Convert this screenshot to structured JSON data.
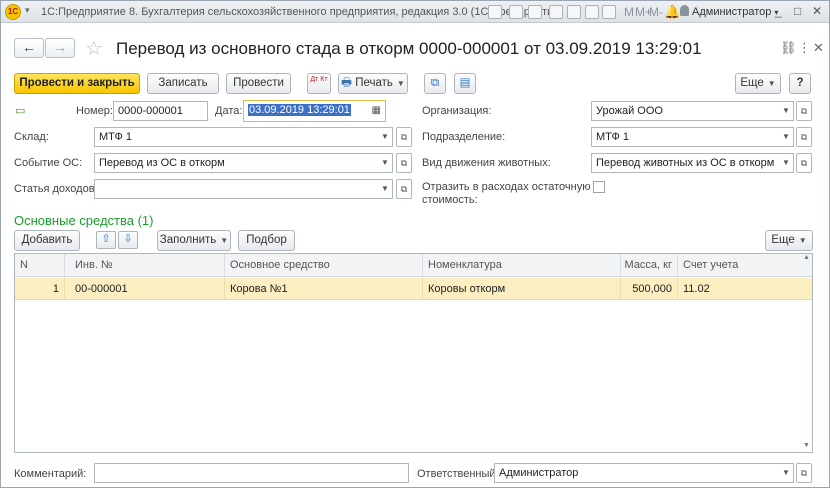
{
  "window": {
    "app_title": "1С:Предприятие 8. Бухгалтерия сельскохозяйственного предприятия, редакция 3.0  (1С:Предприятие)",
    "logo": "1С",
    "user": "Администратор",
    "toolbar_m_labels": [
      "M",
      "M+",
      "M-"
    ]
  },
  "document": {
    "title": "Перевод из основного стада в откорм 0000-000001 от 03.09.2019 13:29:01"
  },
  "toolbar": {
    "post_close": "Провести и закрыть",
    "write": "Записать",
    "post": "Провести",
    "dt_kt": "Дт Кт",
    "print": "Печать",
    "more": "Еще",
    "help": "?"
  },
  "form": {
    "number_label": "Номер:",
    "number_value": "0000-000001",
    "date_label": "Дата:",
    "date_value": "03.09.2019 13:29:01",
    "warehouse_label": "Склад:",
    "warehouse_value": "МТФ 1",
    "event_label": "Событие ОС:",
    "event_value": "Перевод из ОС в откорм",
    "income_label": "Статья доходов:",
    "income_value": "",
    "org_label": "Организация:",
    "org_value": "Урожай ООО",
    "dept_label": "Подразделение:",
    "dept_value": "МТФ 1",
    "movement_label": "Вид движения животных:",
    "movement_value": "Перевод животных из ОС в откорм",
    "reflect_label_1": "Отразить в расходах остаточную",
    "reflect_label_2": "стоимость:",
    "comment_label": "Комментарий:",
    "comment_value": "",
    "responsible_label": "Ответственный:",
    "responsible_value": "Администратор"
  },
  "table_section": {
    "title": "Основные средства (1)",
    "add": "Добавить",
    "fill": "Заполнить",
    "pick": "Подбор",
    "more": "Еще",
    "columns": [
      "N",
      "Инв. №",
      "Основное средство",
      "Номенклатура",
      "Масса, кг",
      "Счет учета"
    ],
    "rows": [
      [
        "1",
        "00-000001",
        "Корова №1",
        "Коровы откорм",
        "500,000",
        "11.02"
      ]
    ]
  }
}
